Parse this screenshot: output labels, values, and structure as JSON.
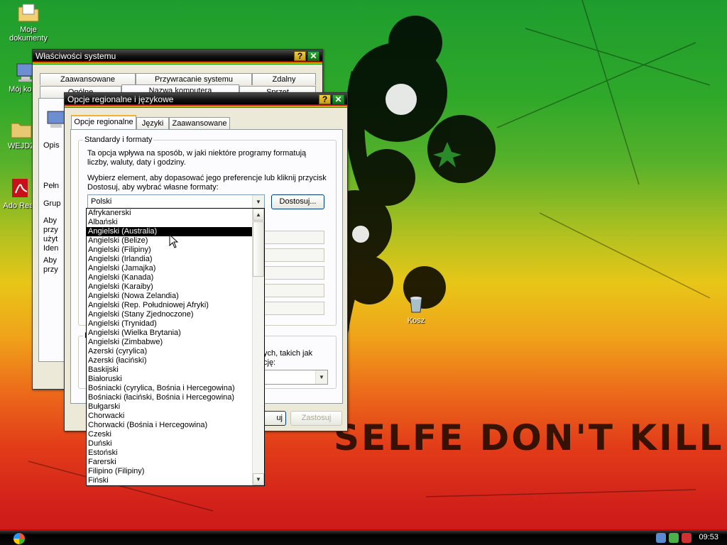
{
  "desktop": {
    "icons": [
      {
        "name": "moje-dokumenty",
        "label": "Moje dokumenty",
        "icon": "folder-documents-icon"
      },
      {
        "name": "moj-komputer",
        "label": "Mój komp",
        "icon": "computer-icon"
      },
      {
        "name": "wejdz",
        "label": "WEJDŹ",
        "icon": "folder-icon"
      },
      {
        "name": "adobe-reader",
        "label": "Ado Read",
        "icon": "pdf-icon"
      },
      {
        "name": "kosz",
        "label": "Kosz",
        "icon": "recycle-bin-icon"
      }
    ],
    "wallpaper_text": "SELFE DON'T KILL"
  },
  "system_props": {
    "title": "Właściwości systemu",
    "tabs_row1": [
      "Zaawansowane",
      "Przywracanie systemu",
      "Zdalny"
    ],
    "tabs_row2": [
      "Ogólne",
      "Nazwa komputera",
      "Sprzęt"
    ],
    "partial_labels": [
      "Opis",
      "Pełn",
      "Grup",
      "Aby",
      "przy",
      "użyt",
      "Iden",
      "Aby",
      "przy"
    ]
  },
  "regional": {
    "title": "Opcje regionalne i językowe",
    "tabs": [
      "Opcje regionalne",
      "Języki",
      "Zaawansowane"
    ],
    "group_standards": "Standardy i formaty",
    "desc1": "Ta opcja wpływa na sposób, w jaki niektóre programy formatują liczby, waluty, daty i godziny.",
    "desc2": "Wybierz element, aby dopasować jego preferencje lub kliknij przycisk Dostosuj, aby wybrać własne formaty:",
    "combo_value": "Polski",
    "customize_button": "Dostosuj...",
    "location_partial": "ych, takich jak",
    "location_partial2": "cję:",
    "location_legend": "L",
    "ok_partial": "uj",
    "apply_button": "Zastosuj"
  },
  "dropdown": {
    "selected_index": 2,
    "items": [
      "Afrykanerski",
      "Albański",
      "Angielski (Australia)",
      "Angielski (Belize)",
      "Angielski (Filipiny)",
      "Angielski (Irlandia)",
      "Angielski (Jamajka)",
      "Angielski (Kanada)",
      "Angielski (Karaiby)",
      "Angielski (Nowa Zelandia)",
      "Angielski (Rep. Południowej Afryki)",
      "Angielski (Stany Zjednoczone)",
      "Angielski (Trynidad)",
      "Angielski (Wielka Brytania)",
      "Angielski (Zimbabwe)",
      "Azerski (cyrylica)",
      "Azerski (łaciński)",
      "Baskijski",
      "Białoruski",
      "Bośniacki (cyrylica, Bośnia i Hercegowina)",
      "Bośniacki (łaciński, Bośnia i Hercegowina)",
      "Bułgarski",
      "Chorwacki",
      "Chorwacki (Bośnia i Hercegowina)",
      "Czeski",
      "Duński",
      "Estoński",
      "Farerski",
      "Filipino (Filipiny)",
      "Fiński"
    ]
  },
  "taskbar": {
    "clock": "09:53"
  }
}
